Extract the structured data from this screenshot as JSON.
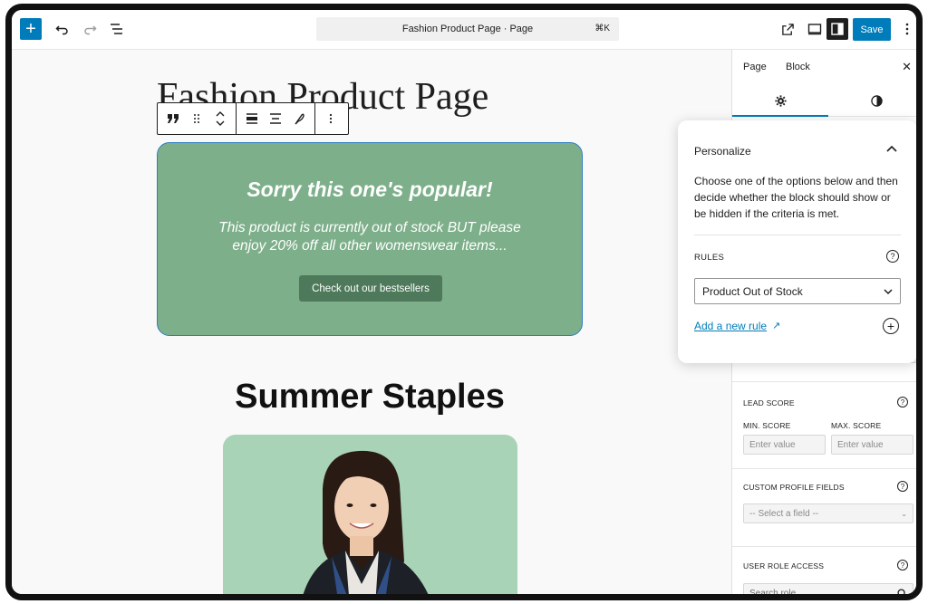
{
  "topbar": {
    "add_label": "+",
    "doc_title": "Fashion Product Page · Page",
    "shortcut": "⌘K",
    "save_label": "Save"
  },
  "canvas": {
    "page_title": "Fashion Product Page",
    "promo": {
      "heading": "Sorry this one's popular!",
      "text": "This product is currently out of stock BUT please enjoy 20% off all other womenswear items...",
      "button": "Check out our bestsellers",
      "background": "#7daf8a"
    },
    "section_title": "Summer Staples"
  },
  "sidebar": {
    "tabs": [
      {
        "label": "Page"
      },
      {
        "label": "Block"
      }
    ],
    "lead_score": {
      "label": "LEAD SCORE",
      "min_label": "MIN. SCORE",
      "max_label": "MAX. SCORE",
      "min_placeholder": "Enter value",
      "max_placeholder": "Enter value"
    },
    "custom_fields": {
      "label": "CUSTOM PROFILE FIELDS",
      "select": "-- Select a field --"
    },
    "user_role": {
      "label": "USER ROLE ACCESS",
      "placeholder": "Search role"
    }
  },
  "popover": {
    "title": "Personalize",
    "description": "Choose one of the options below and then decide whether the block should show or be hidden if the criteria is met.",
    "rules_label": "RULES",
    "rule_selected": "Product Out of Stock",
    "add_rule_link": "Add a new rule",
    "add_rule_arrow": "↗"
  },
  "colors": {
    "accent": "#007cba",
    "promo_button": "#4e7a5b",
    "product_card": "#a9d3b6"
  }
}
